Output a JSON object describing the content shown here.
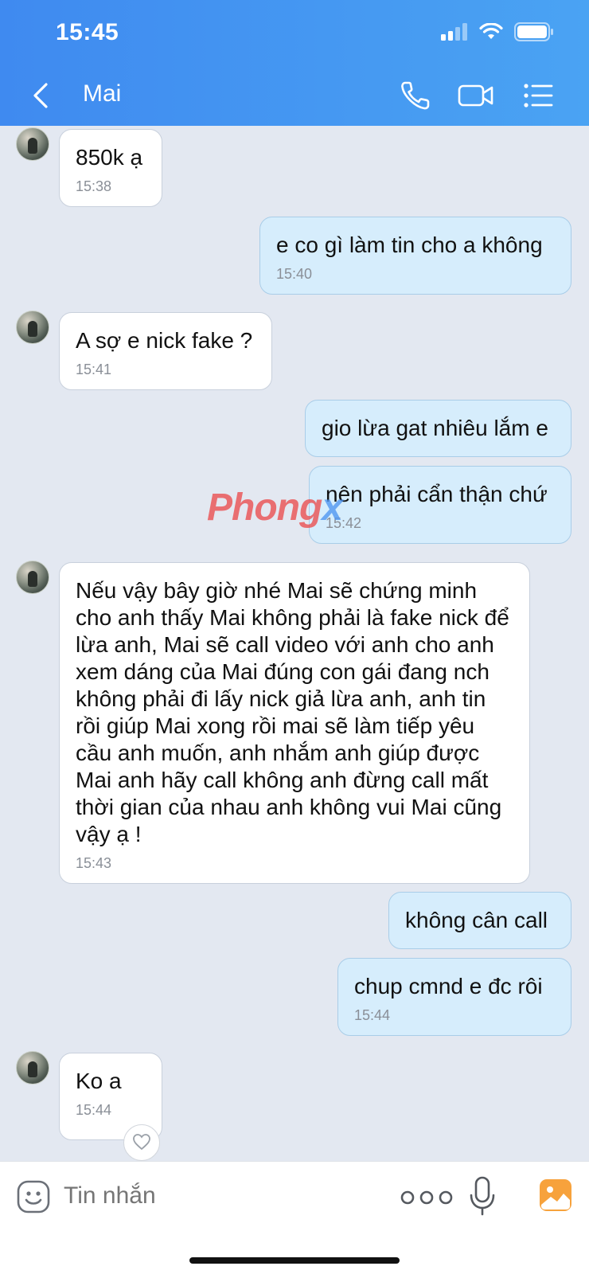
{
  "status": {
    "time": "15:45"
  },
  "header": {
    "title": "Mai"
  },
  "messages": [
    {
      "dir": "in",
      "text": "850k ạ",
      "time": "15:38"
    },
    {
      "dir": "out",
      "text": "e co gì làm tin cho a không",
      "time": "15:40"
    },
    {
      "dir": "in",
      "text": "A sợ e nick fake ?",
      "time": "15:41"
    },
    {
      "dir": "out",
      "text": "gio lừa gat nhiêu lắm e",
      "time": ""
    },
    {
      "dir": "out",
      "text": "nên phải cẩn thận chứ",
      "time": "15:42"
    },
    {
      "dir": "in",
      "text": " Nếu vậy bây giờ nhé Mai sẽ chứng minh cho anh thấy Mai không phải là fake nick để lừa anh, Mai sẽ call video với anh cho anh xem dáng của Mai đúng con gái đang nch không phải đi lấy nick giả lừa anh, anh tin rồi giúp Mai xong rồi mai sẽ làm tiếp yêu cầu anh muốn, anh nhắm anh giúp được Mai anh hãy call không anh đừng call mất thời gian của nhau anh không vui Mai cũng vậy ạ !",
      "time": "15:43"
    },
    {
      "dir": "out",
      "text": "không cân call",
      "time": ""
    },
    {
      "dir": "out",
      "text": "chup cmnd e đc rôi",
      "time": "15:44"
    },
    {
      "dir": "in",
      "text": "Ko a",
      "time": "15:44"
    }
  ],
  "watermark": {
    "main": "Phong",
    "accent": "x"
  },
  "composer": {
    "placeholder": "Tin nhắn"
  }
}
